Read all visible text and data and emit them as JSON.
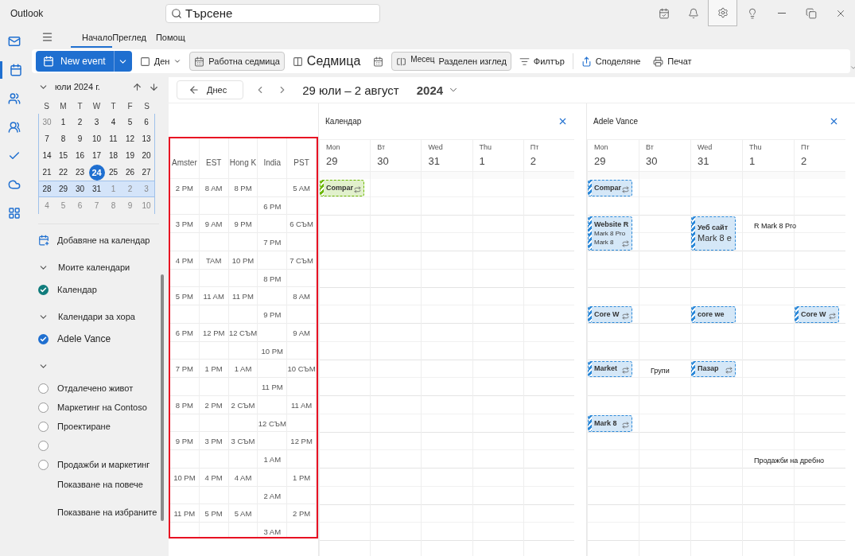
{
  "window": {
    "title": "Outlook"
  },
  "search": {
    "value": "Търсене"
  },
  "title_buttons": [
    {
      "kind": "todo",
      "selected": false
    },
    {
      "kind": "bell",
      "selected": false
    },
    {
      "kind": "settings",
      "selected": true
    },
    {
      "kind": "tips",
      "selected": false
    },
    {
      "kind": "minimize",
      "selected": false
    },
    {
      "kind": "restore",
      "selected": false
    },
    {
      "kind": "close",
      "selected": false
    }
  ],
  "rail": [
    {
      "kind": "mail",
      "selected": false
    },
    {
      "kind": "calendar",
      "selected": true
    },
    {
      "kind": "people",
      "selected": false
    },
    {
      "kind": "groups",
      "selected": false
    },
    {
      "kind": "todo",
      "selected": false
    },
    {
      "kind": "cloud",
      "selected": false
    },
    {
      "kind": "apps",
      "selected": false
    }
  ],
  "ribbon_tabs": [
    {
      "label": "Начало",
      "selected": true
    },
    {
      "label": "Преглед",
      "selected": false
    },
    {
      "label": "Помощ",
      "selected": false
    }
  ],
  "toolbar": [
    {
      "kind": "new",
      "label": "New event"
    },
    {
      "kind": "day",
      "label": "Ден",
      "selected": false,
      "dropdown": true
    },
    {
      "kind": "workweek",
      "label": "Работна седмица",
      "selected": true
    },
    {
      "kind": "week",
      "label": "Седмица",
      "selected": false
    },
    {
      "kind": "month",
      "selected": false
    },
    {
      "kind": "split",
      "caption": "Месец",
      "label": "Разделен изглед",
      "selected": true
    },
    {
      "kind": "filter",
      "label": "Филтър",
      "selected": false
    },
    {
      "kind": "share",
      "label": "Споделяне",
      "selected": false
    },
    {
      "kind": "print",
      "label": "Печат",
      "selected": false
    }
  ],
  "mini_calendar": {
    "month": "юли 2024 г.",
    "weekdays": [
      "S",
      "M",
      "T",
      "W",
      "T",
      "F",
      "S"
    ],
    "weeks": [
      {
        "selected": false,
        "days": [
          {
            "label": "30",
            "muted": true,
            "today": false
          },
          {
            "label": "1",
            "muted": false,
            "today": false
          },
          {
            "label": "2",
            "muted": false,
            "today": false
          },
          {
            "label": "3",
            "muted": false,
            "today": false
          },
          {
            "label": "4",
            "muted": false,
            "today": false
          },
          {
            "label": "5",
            "muted": false,
            "today": false
          },
          {
            "label": "6",
            "muted": false,
            "today": false
          }
        ]
      },
      {
        "selected": false,
        "days": [
          {
            "label": "7",
            "muted": false,
            "today": false
          },
          {
            "label": "8",
            "muted": false,
            "today": false
          },
          {
            "label": "9",
            "muted": false,
            "today": false
          },
          {
            "label": "10",
            "muted": false,
            "today": false
          },
          {
            "label": "11",
            "muted": false,
            "today": false
          },
          {
            "label": "12",
            "muted": false,
            "today": false
          },
          {
            "label": "13",
            "muted": false,
            "today": false
          }
        ]
      },
      {
        "selected": false,
        "days": [
          {
            "label": "14",
            "muted": false,
            "today": false
          },
          {
            "label": "15",
            "muted": false,
            "today": false
          },
          {
            "label": "16",
            "muted": false,
            "today": false
          },
          {
            "label": "17",
            "muted": false,
            "today": false
          },
          {
            "label": "18",
            "muted": false,
            "today": false
          },
          {
            "label": "19",
            "muted": false,
            "today": false
          },
          {
            "label": "20",
            "muted": false,
            "today": false
          }
        ]
      },
      {
        "selected": false,
        "days": [
          {
            "label": "21",
            "muted": false,
            "today": false
          },
          {
            "label": "22",
            "muted": false,
            "today": false
          },
          {
            "label": "23",
            "muted": false,
            "today": false
          },
          {
            "label": "24",
            "muted": false,
            "today": true
          },
          {
            "label": "25",
            "muted": false,
            "today": false
          },
          {
            "label": "26",
            "muted": false,
            "today": false
          },
          {
            "label": "27",
            "muted": false,
            "today": false
          }
        ]
      },
      {
        "selected": true,
        "days": [
          {
            "label": "28",
            "muted": false,
            "today": false
          },
          {
            "label": "29",
            "muted": false,
            "today": false
          },
          {
            "label": "30",
            "muted": false,
            "today": false
          },
          {
            "label": "31",
            "muted": false,
            "today": false
          },
          {
            "label": "1",
            "muted": true,
            "today": false
          },
          {
            "label": "2",
            "muted": true,
            "today": false
          },
          {
            "label": "3",
            "muted": true,
            "today": false
          }
        ]
      },
      {
        "selected": false,
        "days": [
          {
            "label": "4",
            "muted": true,
            "today": false
          },
          {
            "label": "5",
            "muted": true,
            "today": false
          },
          {
            "label": "6",
            "muted": true,
            "today": false
          },
          {
            "label": "7",
            "muted": true,
            "today": false
          },
          {
            "label": "8",
            "muted": true,
            "today": false
          },
          {
            "label": "9",
            "muted": true,
            "today": false
          },
          {
            "label": "10",
            "muted": true,
            "today": false
          }
        ]
      }
    ]
  },
  "add_calendar": "Добавяне на календар",
  "calendar_groups": [
    {
      "label": "Моите календари",
      "expanded": true,
      "items": [
        {
          "label": "Календар",
          "checked": true,
          "color": "#107c7c"
        }
      ]
    },
    {
      "label": "Календари за хора",
      "expanded": true,
      "items": [
        {
          "label": "Adele Vance",
          "checked": true,
          "color": "#1f6fd0"
        }
      ]
    },
    {
      "expanded": true,
      "items": [
        {
          "label": "Отдалечено живот",
          "checked": false
        },
        {
          "label": "Маркетинг на Contoso",
          "checked": false
        },
        {
          "label": "Проектиране",
          "checked": false
        },
        {
          "checked": false
        },
        {
          "label": "Продажби и маркетинг",
          "checked": false
        }
      ]
    }
  ],
  "show_more": "Показване на повече",
  "show_selected": "Показване на избраните",
  "nav": {
    "today": "Днес",
    "range": "29 юли – 2 август",
    "year": "2024"
  },
  "time_zones": [
    {
      "label": "Amster",
      "half_hour": false,
      "times": [
        "2 PM",
        "3 PM",
        "4 PM",
        "5 PM",
        "6 PM",
        "7 PM",
        "8 PM",
        "9 PM",
        "10 PM",
        "11 PM"
      ]
    },
    {
      "label": "EST",
      "half_hour": false,
      "times": [
        "8 AM",
        "9 AM",
        "TAM",
        "11 AM",
        "12 PM",
        "1 PM",
        "2 PM",
        "3 PM",
        "4 PM",
        "5 PM"
      ]
    },
    {
      "label": "Hong K",
      "half_hour": false,
      "times": [
        "8 PM",
        "9 PM",
        "10 PM",
        "11 PM",
        "12 СЪМ",
        "1 AM",
        "2 СЪМ",
        "3 СЪМ",
        "4 AM",
        "5 AM"
      ]
    },
    {
      "label": "India",
      "half_hour": true,
      "times": [
        "6 PM",
        "7 PM",
        "8 PM",
        "9 PM",
        "10 PM",
        "11 PM",
        "12 СЪМ",
        "1 AM",
        "2 AM",
        "3 AM"
      ]
    },
    {
      "label": "PST",
      "half_hour": false,
      "times": [
        "5 AM",
        "6 СЪМ",
        "7 СЪМ",
        "8 AM",
        "9 AM",
        "10 СЪМ",
        "11 AM",
        "12 PM",
        "1 PM",
        "2 PM"
      ]
    }
  ],
  "panels": [
    {
      "title": "Календар",
      "days": [
        {
          "weekday": "Mon",
          "date": "29",
          "slots": [
            {
              "kind": "short-event",
              "color": "#6bb700",
              "lines": [
                "Compar"
              ],
              "recurring": true
            }
          ]
        },
        {
          "weekday": "Вт",
          "date": "30"
        },
        {
          "weekday": "Wed",
          "date": "31"
        },
        {
          "weekday": "Thu",
          "date": "1"
        },
        {
          "weekday": "Пт",
          "date": "2"
        }
      ]
    },
    {
      "title": "Adele Vance",
      "days": [
        {
          "weekday": "Mon",
          "date": "29",
          "slots": [
            {
              "kind": "short-event",
              "color": "#2b88d8",
              "lines": [
                "Compar"
              ],
              "recurring": true
            },
            {
              "kind": "gap"
            },
            {
              "kind": "long-event",
              "color": "#2b88d8",
              "lines": [
                "Website R",
                "Mark 8 Pro",
                "Mark 8"
              ],
              "recurring": true
            },
            {
              "kind": "gap"
            },
            {
              "kind": "gap"
            },
            {
              "kind": "gap"
            },
            {
              "kind": "gap"
            },
            {
              "kind": "short-event",
              "color": "#2b88d8",
              "lines": [
                "Core W"
              ],
              "recurring": true
            },
            {
              "kind": "gap"
            },
            {
              "kind": "gap"
            },
            {
              "kind": "short-event",
              "color": "#2b88d8",
              "lines": [
                "Market"
              ],
              "recurring": true
            },
            {
              "kind": "gap"
            },
            {
              "kind": "gap"
            },
            {
              "kind": "short-event",
              "color": "#2b88d8",
              "lines": [
                "Mark 8"
              ],
              "recurring": true
            }
          ]
        },
        {
          "weekday": "Вт",
          "date": "30",
          "slots": [
            {
              "kind": "gap"
            },
            {
              "kind": "gap"
            },
            {
              "kind": "gap"
            },
            {
              "kind": "gap"
            },
            {
              "kind": "gap"
            },
            {
              "kind": "gap"
            },
            {
              "kind": "gap"
            },
            {
              "kind": "gap"
            },
            {
              "kind": "gap"
            },
            {
              "kind": "gap"
            },
            {
              "kind": "note",
              "lines": [
                "Групи"
              ]
            }
          ]
        },
        {
          "weekday": "Wed",
          "date": "31",
          "slots": [
            {
              "kind": "gap"
            },
            {
              "kind": "gap"
            },
            {
              "kind": "long-event",
              "color": "#2b88d8",
              "lines": [
                "Уеб сайт",
                "Mark 8 e"
              ],
              "recurring": false
            },
            {
              "kind": "gap"
            },
            {
              "kind": "gap"
            },
            {
              "kind": "gap"
            },
            {
              "kind": "gap"
            },
            {
              "kind": "short-event",
              "color": "#2b88d8",
              "lines": [
                "core we"
              ],
              "recurring": false
            },
            {
              "kind": "gap"
            },
            {
              "kind": "gap"
            },
            {
              "kind": "short-event",
              "color": "#2b88d8",
              "lines": [
                "Пазар"
              ],
              "recurring": true
            }
          ]
        },
        {
          "weekday": "Thu",
          "date": "1",
          "slots": [
            {
              "kind": "gap"
            },
            {
              "kind": "gap"
            },
            {
              "kind": "note",
              "lines": [
                "R Mark 8 Pro"
              ]
            },
            {
              "kind": "gap"
            },
            {
              "kind": "gap"
            },
            {
              "kind": "gap"
            },
            {
              "kind": "gap"
            },
            {
              "kind": "gap"
            },
            {
              "kind": "gap"
            },
            {
              "kind": "gap"
            },
            {
              "kind": "gap"
            },
            {
              "kind": "gap"
            },
            {
              "kind": "gap"
            },
            {
              "kind": "gap"
            },
            {
              "kind": "gap"
            },
            {
              "kind": "note",
              "lines": [
                "Продажби на дребно"
              ]
            }
          ]
        },
        {
          "weekday": "Пт",
          "date": "2",
          "slots": [
            {
              "kind": "gap"
            },
            {
              "kind": "gap"
            },
            {
              "kind": "gap"
            },
            {
              "kind": "gap"
            },
            {
              "kind": "gap"
            },
            {
              "kind": "gap"
            },
            {
              "kind": "gap"
            },
            {
              "kind": "short-event",
              "color": "#2b88d8",
              "lines": [
                "Core W"
              ],
              "recurring": true
            }
          ]
        }
      ]
    }
  ]
}
